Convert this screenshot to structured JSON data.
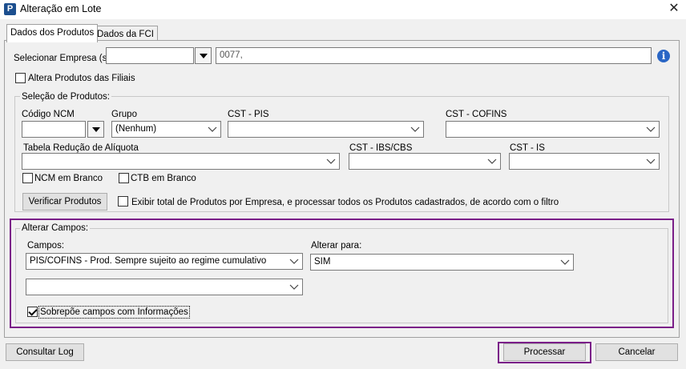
{
  "window": {
    "title": "Alteração em Lote",
    "app_icon": "P",
    "close_glyph": "✕"
  },
  "tabs": [
    {
      "label": "Dados dos Produtos",
      "active": true
    },
    {
      "label": "Dados da FCI",
      "active": false
    }
  ],
  "empresa": {
    "label": "Selecionar Empresa (s):",
    "value": "",
    "list_value": "0077,",
    "info_icon": "i"
  },
  "altera_filiais": {
    "label": "Altera Produtos das Filiais",
    "checked": false
  },
  "selecao": {
    "legend": "Seleção de Produtos:",
    "codigo_ncm": {
      "label": "Código NCM",
      "value": ""
    },
    "grupo": {
      "label": "Grupo",
      "value": "(Nenhum)"
    },
    "cst_pis": {
      "label": "CST - PIS",
      "value": ""
    },
    "cst_cofins": {
      "label": "CST - COFINS",
      "value": ""
    },
    "tabela_reducao": {
      "label": "Tabela Redução de Alíquota",
      "value": ""
    },
    "cst_ibs_cbs": {
      "label": "CST - IBS/CBS",
      "value": ""
    },
    "cst_is": {
      "label": "CST - IS",
      "value": ""
    },
    "ncm_branco": {
      "label": "NCM em Branco",
      "checked": false
    },
    "ctb_branco": {
      "label": "CTB em Branco",
      "checked": false
    },
    "verificar_button": "Verificar Produtos",
    "exibir_total": {
      "label": "Exibir total de Produtos por Empresa, e processar todos os Produtos cadastrados, de acordo com o filtro",
      "checked": false
    }
  },
  "alterar": {
    "legend": "Alterar Campos:",
    "campos_label": "Campos:",
    "campos_value": "PIS/COFINS - Prod. Sempre sujeito ao regime cumulativo",
    "campos_value_2": "",
    "alterar_para_label": "Alterar para:",
    "alterar_para_value": "SIM",
    "sobrepoe": {
      "label": "Sobrepõe campos com Informações",
      "checked": true
    }
  },
  "footer": {
    "consultar_log": "Consultar Log",
    "processar": "Processar",
    "cancelar": "Cancelar"
  },
  "colors": {
    "highlight": "#7a1e88",
    "info_blue": "#2a66c5",
    "app_icon_bg": "#1c4f8f"
  }
}
